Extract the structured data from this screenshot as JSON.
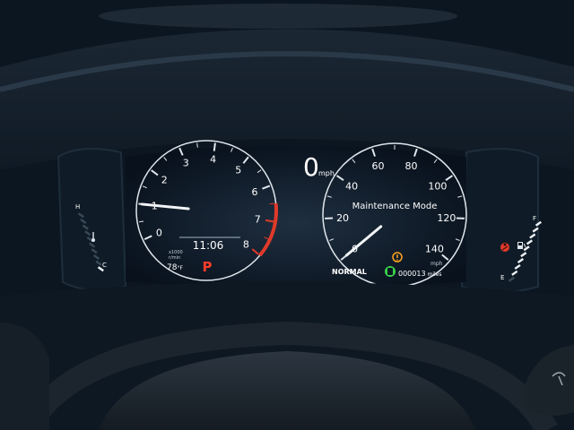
{
  "tachometer": {
    "ticks": [
      "0",
      "1",
      "2",
      "3",
      "4",
      "5",
      "6",
      "7",
      "8"
    ],
    "unit_line1": "x1000",
    "unit_line2": "r/min",
    "rpm_value": 1.0,
    "redline_start": 6.5
  },
  "speedometer": {
    "ticks": [
      "0",
      "20",
      "40",
      "60",
      "80",
      "100",
      "120",
      "140"
    ],
    "unit": "mph",
    "speed_value": 0
  },
  "center": {
    "speed_digital": "0",
    "speed_unit": "mph",
    "message": "Maintenance Mode",
    "clock": "11:06",
    "gear": "P",
    "outside_temp": "78",
    "temp_unit": "°F",
    "drive_mode": "NORMAL",
    "odometer": "000013",
    "odometer_unit": "miles"
  },
  "temp_gauge": {
    "hot_label": "H",
    "cold_label": "C",
    "level": 0.1
  },
  "fuel_gauge": {
    "full_label": "F",
    "empty_label": "E",
    "level": 0.95
  },
  "colors": {
    "needle": "#f2f5f7",
    "redline": "#e03a2a",
    "gear_p": "#ff3b2a",
    "warning_amber": "#ffa51e",
    "eco_green": "#39d24a",
    "dial_white": "#ffffff"
  },
  "icons": [
    "temperature-icon",
    "fuel-pump-icon",
    "seatbelt-warning-icon",
    "maintenance-warning-icon",
    "eco-assist-icon",
    "wiper-icon"
  ]
}
